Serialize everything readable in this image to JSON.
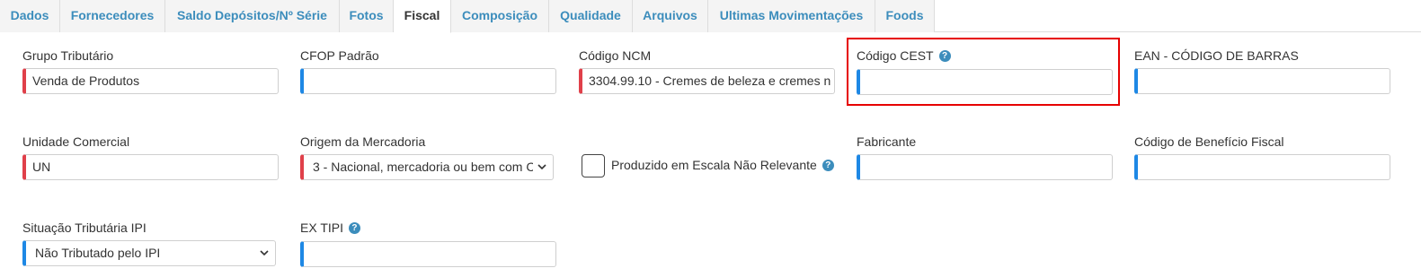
{
  "tabs": [
    {
      "label": "Dados"
    },
    {
      "label": "Fornecedores"
    },
    {
      "label": "Saldo Depósitos/Nº Série"
    },
    {
      "label": "Fotos"
    },
    {
      "label": "Fiscal",
      "active": true
    },
    {
      "label": "Composição"
    },
    {
      "label": "Qualidade"
    },
    {
      "label": "Arquivos"
    },
    {
      "label": "Ultimas Movimentações"
    },
    {
      "label": "Foods"
    }
  ],
  "fields": {
    "grupo_tributario": {
      "label": "Grupo Tributário",
      "value": "Venda de Produtos"
    },
    "cfop_padrao": {
      "label": "CFOP Padrão",
      "value": ""
    },
    "codigo_ncm": {
      "label": "Código NCM",
      "value": "3304.99.10 - Cremes de beleza e cremes n"
    },
    "codigo_cest": {
      "label": "Código CEST",
      "value": ""
    },
    "ean": {
      "label": "EAN - CÓDIGO DE BARRAS",
      "value": ""
    },
    "unidade_comercial": {
      "label": "Unidade Comercial",
      "value": "UN"
    },
    "origem_mercadoria": {
      "label": "Origem da Mercadoria",
      "value": "3 - Nacional, mercadoria ou bem com C"
    },
    "produzido_escala": {
      "label": "Produzido em Escala Não Relevante",
      "checked": false
    },
    "fabricante": {
      "label": "Fabricante",
      "value": ""
    },
    "codigo_beneficio": {
      "label": "Código de Benefício Fiscal",
      "value": ""
    },
    "situacao_ipi": {
      "label": "Situação Tributária IPI",
      "value": "Não Tributado pelo IPI"
    },
    "ex_tipi": {
      "label": "EX TIPI",
      "value": ""
    }
  },
  "help_glyph": "?",
  "colors": {
    "tab_link": "#3c8dbc",
    "required_marker": "#e0404a",
    "optional_marker": "#1e88e5",
    "highlight": "#e60000"
  }
}
